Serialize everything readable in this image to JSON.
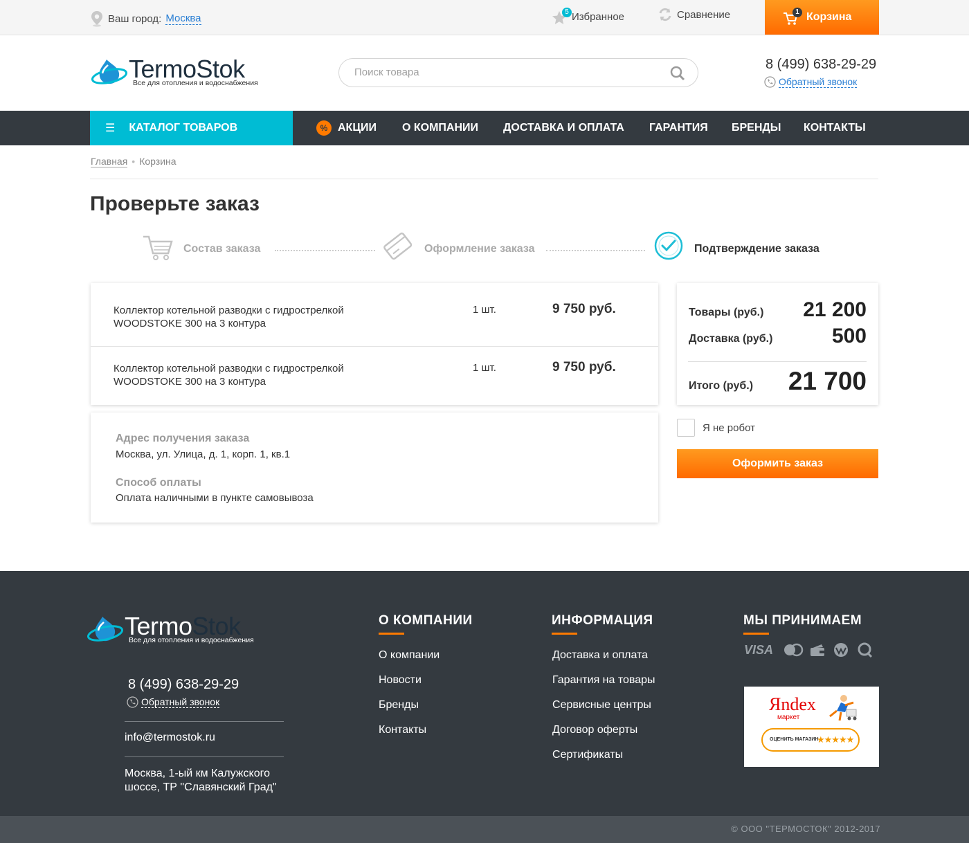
{
  "topbar": {
    "city_label": "Ваш город:",
    "city": "Москва",
    "favorites": "Избранное",
    "favorites_count": "5",
    "compare": "Сравнение",
    "cart": "Корзина",
    "cart_count": "1"
  },
  "header": {
    "logo_main": "Termo",
    "logo_accent": "Stok",
    "logo_sub": "Все для отопления и водоснабжения",
    "search_placeholder": "Поиск товара",
    "phone": "8 (499) 638-29-29",
    "callback": "Обратный звонок"
  },
  "nav": {
    "catalog": "КАТАЛОГ ТОВАРОВ",
    "items": [
      "АКЦИИ",
      "О КОМПАНИИ",
      "ДОСТАВКА И ОПЛАТА",
      "ГАРАНТИЯ",
      "БРЕНДЫ",
      "КОНТАКТЫ"
    ],
    "promo_badge": "%"
  },
  "breadcrumb": {
    "home": "Главная",
    "current": "Корзина"
  },
  "page_title": "Проверьте заказ",
  "steps": [
    {
      "label": "Состав заказа",
      "state": "done"
    },
    {
      "label": "Оформление заказа",
      "state": "done"
    },
    {
      "label": "Подтверждение заказа",
      "state": "active"
    }
  ],
  "order_items": [
    {
      "name_line1": "Коллектор котельной разводки с гидрострелкой",
      "name_line2": "WOODSTOKE 300 на 3 контура",
      "qty": "1 шт.",
      "price": "9 750 руб."
    },
    {
      "name_line1": "Коллектор котельной разводки с гидрострелкой",
      "name_line2": "WOODSTOKE 300 на 3 контура",
      "qty": "1 шт.",
      "price": "9 750 руб."
    }
  ],
  "delivery": {
    "address_label": "Адрес получения заказа",
    "address": "Москва, ул. Улица, д. 1, корп. 1, кв.1",
    "payment_label": "Способ оплаты",
    "payment": "Оплата наличными в пункте самовывоза"
  },
  "summary": {
    "goods_label": "Товары (руб.)",
    "goods": "21 200",
    "delivery_label": "Доставка (руб.)",
    "delivery": "500",
    "total_label": "Итого (руб.)",
    "total": "21 700"
  },
  "captcha_label": "Я не робот",
  "order_button": "Оформить заказ",
  "footer": {
    "phone": "8 (499) 638-29-29",
    "callback": "Обратный звонок",
    "email": "info@termostok.ru",
    "address_line1": "Москва, 1-ый км Калужского",
    "address_line2": "шоссе, ТР \"Славянский Град\"",
    "col1_title": "О КОМПАНИИ",
    "col1_links": [
      "О компании",
      "Новости",
      "Бренды",
      "Контакты"
    ],
    "col2_title": "ИНФОРМАЦИЯ",
    "col2_links": [
      "Доставка и оплата",
      "Гарантия на товары",
      "Сервисные центры",
      "Договор оферты",
      "Сертификаты"
    ],
    "col3_title": "МЫ ПРИНИМАЕМ",
    "payment_icons": [
      "visa-icon",
      "mastercard-icon",
      "wallet-icon",
      "webmoney-icon",
      "qiwi-icon"
    ],
    "visa": "VISA",
    "ym_brand": "Яndex",
    "ym_market": "маркет",
    "ym_rate": "ОЦЕНИТЬ МАГАЗИН",
    "ym_stars": "★★★★★",
    "copyright": "© ООО \"ТЕРМОСТОК\" 2012-2017"
  },
  "colors": {
    "accent_orange": "#ff7a00",
    "accent_cyan": "#00bcd4",
    "nav_dark": "#343a40",
    "link_blue": "#2a7fd4"
  }
}
